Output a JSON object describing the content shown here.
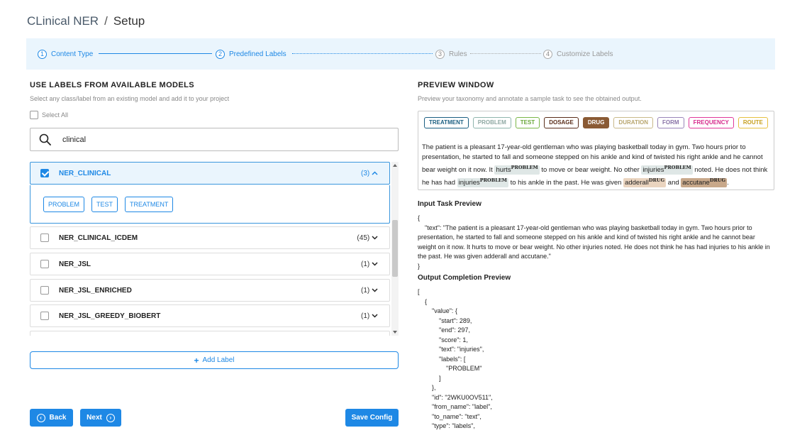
{
  "header": {
    "project": "CLinical NER",
    "separator": "/",
    "page": "Setup"
  },
  "stepper": [
    {
      "num": "1",
      "label": "Content Type",
      "state": "done"
    },
    {
      "num": "2",
      "label": "Predefined Labels",
      "state": "active"
    },
    {
      "num": "3",
      "label": "Rules",
      "state": "pending"
    },
    {
      "num": "4",
      "label": "Customize Labels",
      "state": "pending"
    }
  ],
  "left": {
    "heading": "USE LABELS FROM AVAILABLE MODELS",
    "subheading": "Select any class/label from an existing model and add it to your project",
    "select_all": "Select All",
    "search": {
      "value": "clinical",
      "icon": "search-icon"
    },
    "models": [
      {
        "name": "NER_CLINICAL",
        "count": "(3)",
        "checked": true,
        "expanded": true,
        "chevron": "chevron-up-icon"
      },
      {
        "name": "NER_CLINICAL_ICDEM",
        "count": "(45)",
        "checked": false,
        "chevron": "chevron-down-icon"
      },
      {
        "name": "NER_JSL",
        "count": "(1)",
        "checked": false,
        "chevron": "chevron-down-icon"
      },
      {
        "name": "NER_JSL_ENRICHED",
        "count": "(1)",
        "checked": false,
        "chevron": "chevron-down-icon"
      },
      {
        "name": "NER_JSL_GREEDY_BIOBERT",
        "count": "(1)",
        "checked": false,
        "chevron": "chevron-down-icon"
      }
    ],
    "expanded_labels": [
      "PROBLEM",
      "TEST",
      "TREATMENT"
    ],
    "add_label": "Add Label"
  },
  "footer": {
    "back": "Back",
    "next": "Next",
    "save": "Save Config"
  },
  "right": {
    "heading": "PREVIEW WINDOW",
    "subheading": "Preview your taxonomy and annotate a sample task to see the obtained output.",
    "tags": [
      {
        "label": "TREATMENT",
        "color": "#1b5f82",
        "bg": "#ffffff",
        "fg": "#1b5f82"
      },
      {
        "label": "PROBLEM",
        "color": "#8fb5ad",
        "bg": "#ffffff",
        "fg": "#8fa8a3"
      },
      {
        "label": "TEST",
        "color": "#7ab648",
        "bg": "#ffffff",
        "fg": "#6aa83a"
      },
      {
        "label": "DOSAGE",
        "color": "#5a2d1a",
        "bg": "#ffffff",
        "fg": "#5a2d1a"
      },
      {
        "label": "DRUG",
        "color": "#8a5a34",
        "bg": "#8a5a34",
        "fg": "#ffffff"
      },
      {
        "label": "DURATION",
        "color": "#c9b98a",
        "bg": "#ffffff",
        "fg": "#b8a66e"
      },
      {
        "label": "FORM",
        "color": "#9a85b8",
        "bg": "#ffffff",
        "fg": "#8a74a8"
      },
      {
        "label": "FREQUENCY",
        "color": "#e0399a",
        "bg": "#ffffff",
        "fg": "#d62a8c"
      },
      {
        "label": "ROUTE",
        "color": "#e6c040",
        "bg": "#ffffff",
        "fg": "#c7a020"
      }
    ],
    "text": {
      "t1": "The patient is a pleasant 17-year-old gentleman who was playing basketball today in gym. Two hours prior to presentation, he started to fall and someone stepped on his ankle and kind of twisted his right ankle and he cannot bear weight on it now. It ",
      "e1": "hurts",
      "l1": "PROBLEM",
      "t2": " to move or bear weight. No other ",
      "e2": "injuries",
      "l2": "PROBLEM",
      "t3": " noted. He does not think he has had ",
      "e3": "injuries",
      "l3": "PROBLEM",
      "t4": " to his ankle in the past. He was given ",
      "e4": "adderall",
      "l4": "DRUG",
      "t5": " and ",
      "e5": "accutane",
      "l5": "DRUG",
      "t6": "."
    },
    "input_heading": "Input Task Preview",
    "input_json": "{\n    \"text\": \"The patient is a pleasant 17-year-old gentleman who was playing basketball today in gym. Two hours prior to presentation, he started to fall and someone stepped on his ankle and kind of twisted his right ankle and he cannot bear weight on it now. It hurts to move or bear weight. No other injuries noted. He does not think he has had injuries to his ankle in the past. He was given adderall and accutane.\"\n}",
    "output_heading": "Output Completion Preview",
    "output_json": "[\n    {\n        \"value\": {\n            \"start\": 289,\n            \"end\": 297,\n            \"score\": 1,\n            \"text\": \"injuries\",\n            \"labels\": [\n                \"PROBLEM\"\n            ]\n        },\n        \"id\": \"2WKU0OV511\",\n        \"from_name\": \"label\",\n        \"to_name\": \"text\",\n        \"type\": \"labels\","
  }
}
